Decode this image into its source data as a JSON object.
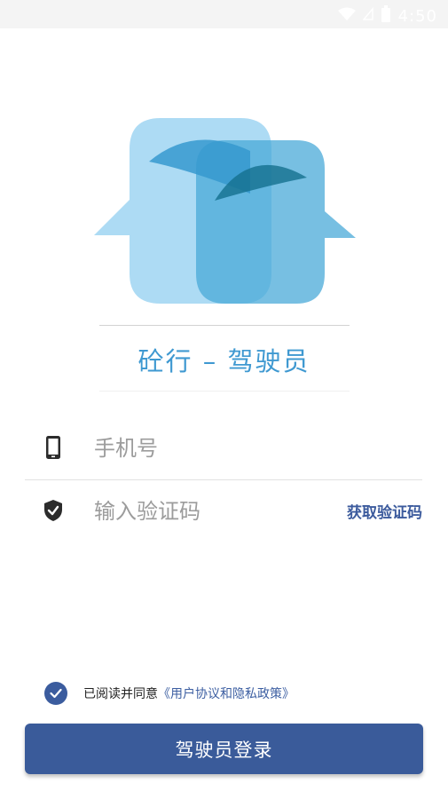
{
  "status_bar": {
    "time": "4:50"
  },
  "app": {
    "title": "砼行 – 驾驶员"
  },
  "form": {
    "phone_placeholder": "手机号",
    "code_placeholder": "输入验证码",
    "get_code_label": "获取验证码"
  },
  "agreement": {
    "checked": true,
    "prefix": "已阅读并同意",
    "link": "《用户协议和隐私政策》"
  },
  "login_button": "驾驶员登录",
  "colors": {
    "brand_blue": "#3a5b9a",
    "title_blue": "#3f99d1",
    "logo_light": "#9fd5f2",
    "logo_mid": "#4aa9d8",
    "logo_dark": "#14708f"
  }
}
